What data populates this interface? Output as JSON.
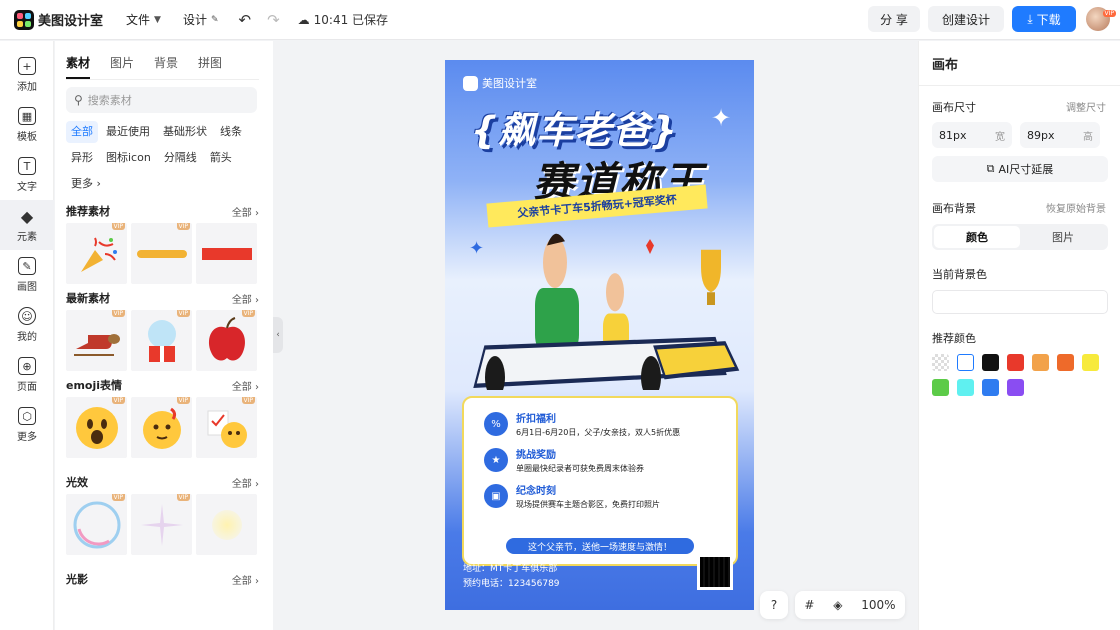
{
  "header": {
    "app_name": "美图设计室",
    "menu_file": "文件",
    "menu_design": "设计",
    "save_status": "10:41 已保存",
    "share_label": "分 享",
    "create_label": "创建设计",
    "download_label": "下载",
    "avatar_badge": "VIP"
  },
  "rail": {
    "items": [
      {
        "label": "添加",
        "icon": "plus-icon"
      },
      {
        "label": "模板",
        "icon": "template-icon"
      },
      {
        "label": "文字",
        "icon": "text-icon"
      },
      {
        "label": "元素",
        "icon": "elements-icon"
      },
      {
        "label": "画图",
        "icon": "draw-icon"
      },
      {
        "label": "我的",
        "icon": "user-icon"
      },
      {
        "label": "页面",
        "icon": "page-icon"
      },
      {
        "label": "更多",
        "icon": "cube-icon"
      }
    ],
    "active": "元素"
  },
  "assets": {
    "tabs": [
      "素材",
      "图片",
      "背景",
      "拼图"
    ],
    "active_tab": "素材",
    "search_placeholder": "搜索素材",
    "chips": [
      "全部",
      "最近使用",
      "基础形状",
      "线条",
      "异形",
      "图标icon",
      "分隔线",
      "箭头",
      "更多"
    ],
    "active_chip": "全部",
    "vip_badge": "VIP",
    "see_all": "全部",
    "sections": [
      {
        "title": "推荐素材"
      },
      {
        "title": "最新素材"
      },
      {
        "title": "emoji表情"
      },
      {
        "title": "光效"
      },
      {
        "title": "光影"
      }
    ]
  },
  "poster": {
    "brand": "美图设计室",
    "title_line1": "{飙车老爸}",
    "title_line2": "赛道称王",
    "ribbon": "父亲节卡丁车5折畅玩+冠军奖杯",
    "items": [
      {
        "heading": "折扣福利",
        "desc": "6月1日-6月20日，父子/女亲技，双人5折优惠"
      },
      {
        "heading": "挑战奖励",
        "desc": "单圈最快纪录者可获免费周末体验券"
      },
      {
        "heading": "纪念时刻",
        "desc": "现场提供赛车主题合影区，免费打印照片"
      }
    ],
    "slogan": "这个父亲节，送他一场速度与激情！",
    "address": "地址：MT卡丁车俱乐部",
    "phone": "预约电话：123456789"
  },
  "canvas_tools": {
    "help": "?",
    "zoom": "100%"
  },
  "right_panel": {
    "title": "画布",
    "size_label": "画布尺寸",
    "adjust_size": "调整尺寸",
    "width_value": "81px",
    "width_unit": "宽",
    "height_value": "89px",
    "height_unit": "高",
    "ai_extend": "AI尺寸延展",
    "bg_label": "画布背景",
    "restore_bg": "恢复原始背景",
    "seg_color": "颜色",
    "seg_image": "图片",
    "current_bg_label": "当前背景色",
    "recommended_label": "推荐颜色",
    "swatches": [
      "transparent",
      "#ffffff",
      "#111111",
      "#e8392b",
      "#f2a24a",
      "#ee6a2a",
      "#f7ea3c",
      "#5ccb48",
      "#5ff0f0",
      "#2f7cf0",
      "#8a4df2"
    ]
  }
}
